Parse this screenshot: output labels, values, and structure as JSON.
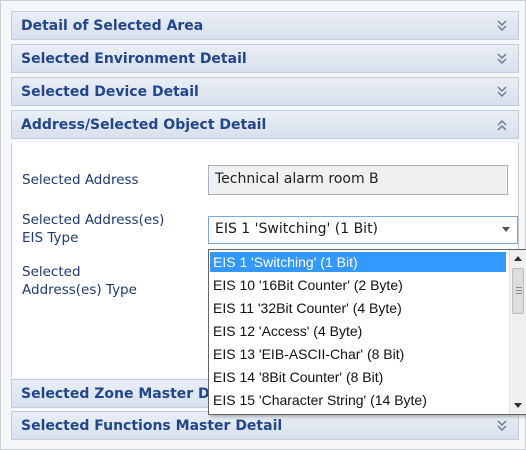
{
  "panels": [
    {
      "title": "Detail of Selected Area",
      "expanded": false
    },
    {
      "title": "Selected Environment Detail",
      "expanded": false
    },
    {
      "title": "Selected Device Detail",
      "expanded": false
    },
    {
      "title": "Address/Selected Object Detail",
      "expanded": true
    },
    {
      "title": "Selected Zone Master Detail",
      "expanded": false
    },
    {
      "title": "Selected Functions Master Detail",
      "expanded": false
    }
  ],
  "address_detail": {
    "selected_address_label": "Selected Address",
    "selected_address_value": "Technical alarm room B",
    "eis_type_label_line1": "Selected Address(es)",
    "eis_type_label_line2": "EIS Type",
    "eis_type_value": "EIS 1 'Switching' (1 Bit)",
    "type_label_line1": "Selected",
    "type_label_line2": "Address(es) Type"
  },
  "dropdown": {
    "options": [
      "EIS 1 'Switching' (1 Bit)",
      "EIS 10 '16Bit Counter' (2 Byte)",
      "EIS 11 '32Bit Counter' (4 Byte)",
      "EIS 12 'Access' (4 Byte)",
      "EIS 13 'EIB-ASCII-Char' (8 Bit)",
      "EIS 14 '8Bit Counter' (8 Bit)",
      "EIS 15 'Character String' (14 Byte)"
    ],
    "selected_index": 0
  },
  "colors": {
    "header_text": "#21468a",
    "label_text": "#1e3a70",
    "selection": "#3399ff"
  }
}
